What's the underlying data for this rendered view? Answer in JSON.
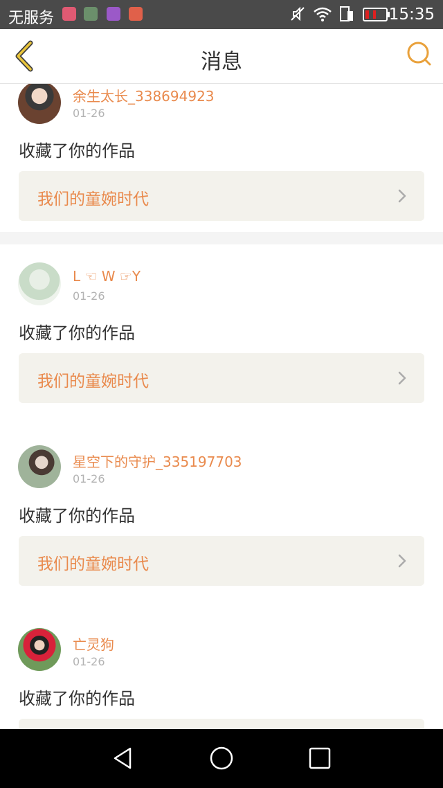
{
  "status_bar": {
    "carrier": "无服务",
    "time": "15:35",
    "app_icon_colors": [
      "#e05a73",
      "#6b8f6b",
      "#9b59c8",
      "#e0604a"
    ],
    "battery_color": "#e02020"
  },
  "header": {
    "title": "消息",
    "back_icon": "chevron-left-icon",
    "search_icon": "search-icon",
    "accent": "#e9a13b"
  },
  "notifications": [
    {
      "username": "余生太长_338694923",
      "date": "01-26",
      "action": "收藏了你的作品",
      "work_title": "我们的童婉时代"
    },
    {
      "username": "L ☜ W ☞Y",
      "date": "01-26",
      "action": "收藏了你的作品",
      "work_title": "我们的童婉时代"
    },
    {
      "username": "星空下的守护_335197703",
      "date": "01-26",
      "action": "收藏了你的作品",
      "work_title": "我们的童婉时代"
    },
    {
      "username": "亡灵狗",
      "date": "01-26",
      "action": "收藏了你的作品",
      "work_title": ""
    }
  ],
  "colors": {
    "username": "#e98a4d",
    "date": "#b3b3b3",
    "work_bg": "#f3f2ec"
  }
}
